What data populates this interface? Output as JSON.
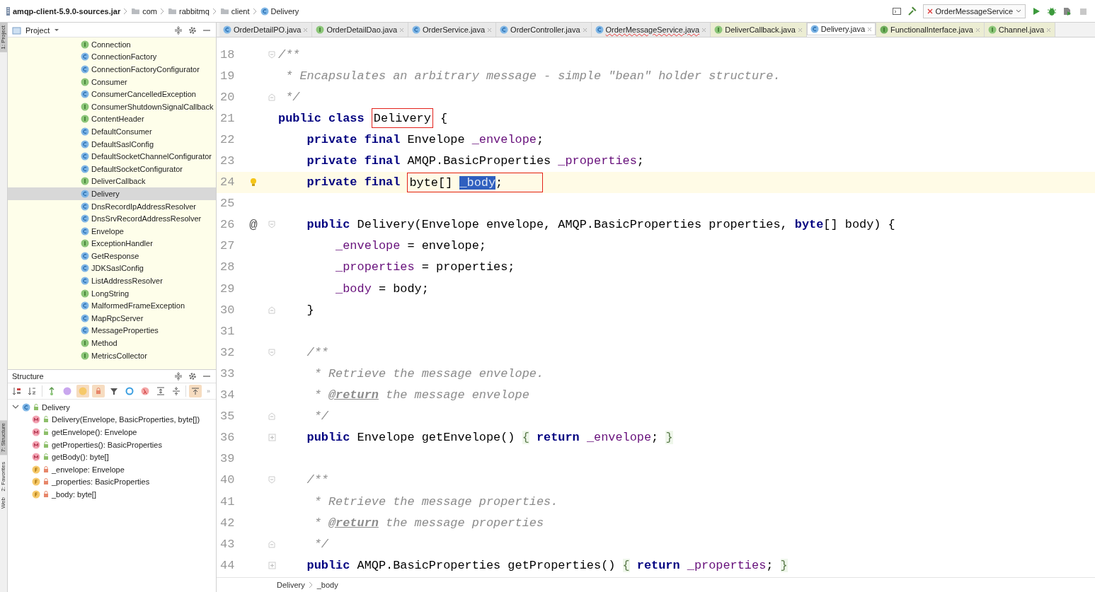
{
  "breadcrumb": [
    {
      "label": "amqp-client-5.9.0-sources.jar",
      "kind": "jar"
    },
    {
      "label": "com",
      "kind": "folder"
    },
    {
      "label": "rabbitmq",
      "kind": "folder"
    },
    {
      "label": "client",
      "kind": "folder"
    },
    {
      "label": "Delivery",
      "kind": "class"
    }
  ],
  "run_config": {
    "label": "OrderMessageService"
  },
  "side_tools": [
    {
      "label": "1: Project",
      "selected": true
    },
    {
      "label": "7: Structure",
      "selected": true
    },
    {
      "label": "2: Favorites",
      "selected": false
    },
    {
      "label": "Web",
      "selected": false
    }
  ],
  "project": {
    "title": "Project",
    "items": [
      {
        "label": "Connection",
        "kind": "interface",
        "selected": false
      },
      {
        "label": "ConnectionFactory",
        "kind": "class",
        "selected": false
      },
      {
        "label": "ConnectionFactoryConfigurator",
        "kind": "class",
        "selected": false
      },
      {
        "label": "Consumer",
        "kind": "interface",
        "selected": false
      },
      {
        "label": "ConsumerCancelledException",
        "kind": "class",
        "selected": false
      },
      {
        "label": "ConsumerShutdownSignalCallback",
        "kind": "interface",
        "selected": false
      },
      {
        "label": "ContentHeader",
        "kind": "interface",
        "selected": false
      },
      {
        "label": "DefaultConsumer",
        "kind": "class",
        "selected": false
      },
      {
        "label": "DefaultSaslConfig",
        "kind": "class",
        "selected": false
      },
      {
        "label": "DefaultSocketChannelConfigurator",
        "kind": "class",
        "selected": false
      },
      {
        "label": "DefaultSocketConfigurator",
        "kind": "class",
        "selected": false
      },
      {
        "label": "DeliverCallback",
        "kind": "interface",
        "selected": false
      },
      {
        "label": "Delivery",
        "kind": "class",
        "selected": true
      },
      {
        "label": "DnsRecordIpAddressResolver",
        "kind": "class",
        "selected": false
      },
      {
        "label": "DnsSrvRecordAddressResolver",
        "kind": "class",
        "selected": false
      },
      {
        "label": "Envelope",
        "kind": "class",
        "selected": false
      },
      {
        "label": "ExceptionHandler",
        "kind": "interface",
        "selected": false
      },
      {
        "label": "GetResponse",
        "kind": "class",
        "selected": false
      },
      {
        "label": "JDKSaslConfig",
        "kind": "class",
        "selected": false
      },
      {
        "label": "ListAddressResolver",
        "kind": "class",
        "selected": false
      },
      {
        "label": "LongString",
        "kind": "interface",
        "selected": false
      },
      {
        "label": "MalformedFrameException",
        "kind": "class",
        "selected": false
      },
      {
        "label": "MapRpcServer",
        "kind": "class",
        "selected": false
      },
      {
        "label": "MessageProperties",
        "kind": "class",
        "selected": false
      },
      {
        "label": "Method",
        "kind": "interface",
        "selected": false
      },
      {
        "label": "MetricsCollector",
        "kind": "interface",
        "selected": false
      }
    ]
  },
  "structure": {
    "title": "Structure",
    "toolbar": [
      {
        "on": false
      },
      {
        "on": false
      },
      {
        "on": false
      },
      {
        "on": false
      },
      {
        "on": true
      },
      {
        "on": true
      },
      {
        "on": false
      },
      {
        "on": false
      },
      {
        "on": false
      },
      {
        "on": false
      },
      {
        "on": false
      },
      {
        "on": true
      }
    ],
    "overflow": "»",
    "tree": [
      {
        "label": "Delivery",
        "kind": "class",
        "locked": false,
        "expanded": true,
        "children": [
          {
            "label": "Delivery(Envelope, BasicProperties, byte[])",
            "kind": "method",
            "locked": false
          },
          {
            "label": "getEnvelope(): Envelope",
            "kind": "method",
            "locked": false
          },
          {
            "label": "getProperties(): BasicProperties",
            "kind": "method",
            "locked": false
          },
          {
            "label": "getBody(): byte[]",
            "kind": "method",
            "locked": false
          },
          {
            "label": "_envelope: Envelope",
            "kind": "field",
            "locked": true
          },
          {
            "label": "_properties: BasicProperties",
            "kind": "field",
            "locked": true
          },
          {
            "label": "_body: byte[]",
            "kind": "field",
            "locked": true
          }
        ]
      }
    ]
  },
  "tabs": [
    {
      "label": "OrderDetailPO.java",
      "kind": "class",
      "selected": false,
      "error": false,
      "color": "#e9e9e9"
    },
    {
      "label": "OrderDetailDao.java",
      "kind": "interface",
      "selected": false,
      "error": false,
      "color": "#e9e9e9"
    },
    {
      "label": "OrderService.java",
      "kind": "class",
      "selected": false,
      "error": false,
      "color": "#e9e9e9"
    },
    {
      "label": "OrderController.java",
      "kind": "class",
      "selected": false,
      "error": false,
      "color": "#e9e9e9"
    },
    {
      "label": "OrderMessageService.java",
      "kind": "class",
      "selected": false,
      "error": true,
      "color": "#e9e9e9"
    },
    {
      "label": "DeliverCallback.java",
      "kind": "interface",
      "selected": false,
      "error": false,
      "color": "#ecedd3"
    },
    {
      "label": "Delivery.java",
      "kind": "class",
      "selected": true,
      "error": false,
      "color": "#ffffff"
    },
    {
      "label": "FunctionalInterface.java",
      "kind": "annotation",
      "selected": false,
      "error": false,
      "color": "#ecedd3"
    },
    {
      "label": "Channel.java",
      "kind": "interface",
      "selected": false,
      "error": false,
      "color": "#ecedd3"
    }
  ],
  "editor": {
    "lines": [
      {
        "num": "18",
        "fold": {
          "kind": "start"
        },
        "tokens": [
          {
            "t": "/**",
            "kind": "comment"
          }
        ]
      },
      {
        "num": "19",
        "tokens": [
          {
            "t": " * Encapsulates an arbitrary message - simple \"bean\" holder structure.",
            "kind": "comment"
          }
        ]
      },
      {
        "num": "20",
        "fold": {
          "kind": "end"
        },
        "tokens": [
          {
            "t": " */",
            "kind": "comment"
          }
        ]
      },
      {
        "num": "21",
        "tokens": [
          {
            "t": "public class ",
            "kind": "keyword"
          },
          {
            "t": "Delivery",
            "kind": "plain",
            "boxed": true
          },
          {
            "t": " {",
            "kind": "plain"
          }
        ]
      },
      {
        "num": "22",
        "tokens": [
          {
            "t": "    private final",
            "kind": "keyword"
          },
          {
            "t": " Envelope ",
            "kind": "plain"
          },
          {
            "t": "_envelope",
            "kind": "field"
          },
          {
            "t": ";",
            "kind": "plain"
          }
        ]
      },
      {
        "num": "23",
        "tokens": [
          {
            "t": "    private final",
            "kind": "keyword"
          },
          {
            "t": " AMQP.BasicProperties ",
            "kind": "plain"
          },
          {
            "t": "_properties",
            "kind": "field"
          },
          {
            "t": ";",
            "kind": "plain"
          }
        ]
      },
      {
        "num": "24",
        "current": true,
        "bulb": true,
        "tokens": [
          {
            "t": "    private final ",
            "kind": "keyword"
          },
          {
            "t": "byte[] ",
            "kind": "plain",
            "boxed": true
          },
          {
            "t": "_body",
            "kind": "selection",
            "boxed": true
          },
          {
            "t": ";",
            "kind": "plain",
            "boxed": true
          }
        ]
      },
      {
        "num": "25",
        "current": false
      },
      {
        "num": "26",
        "gutter_text": "@",
        "fold": {
          "kind": "start"
        },
        "tokens": [
          {
            "t": "    public",
            "kind": "keyword"
          },
          {
            "t": " Delivery(Envelope envelope, AMQP.BasicProperties properties, ",
            "kind": "plain"
          },
          {
            "t": "byte",
            "kind": "keyword"
          },
          {
            "t": "[] body) {",
            "kind": "plain"
          }
        ]
      },
      {
        "num": "27",
        "tokens": [
          {
            "t": "        _envelope",
            "kind": "field"
          },
          {
            "t": " = envelope;",
            "kind": "plain"
          }
        ]
      },
      {
        "num": "28",
        "tokens": [
          {
            "t": "        _properties",
            "kind": "field"
          },
          {
            "t": " = properties;",
            "kind": "plain"
          }
        ]
      },
      {
        "num": "29",
        "tokens": [
          {
            "t": "        _body",
            "kind": "field"
          },
          {
            "t": " = body;",
            "kind": "plain"
          }
        ]
      },
      {
        "num": "30",
        "fold": {
          "kind": "end"
        },
        "tokens": [
          {
            "t": "    }",
            "kind": "plain"
          }
        ]
      },
      {
        "num": "31"
      },
      {
        "num": "32",
        "fold": {
          "kind": "start"
        },
        "tokens": [
          {
            "t": "    /**",
            "kind": "comment"
          }
        ]
      },
      {
        "num": "33",
        "tokens": [
          {
            "t": "     * Retrieve the message envelope.",
            "kind": "comment"
          }
        ]
      },
      {
        "num": "34",
        "tokens": [
          {
            "t": "     * ",
            "kind": "comment"
          },
          {
            "t": "@return",
            "kind": "tag"
          },
          {
            "t": " the message envelope",
            "kind": "comment"
          }
        ]
      },
      {
        "num": "35",
        "fold": {
          "kind": "end"
        },
        "tokens": [
          {
            "t": "     */",
            "kind": "comment"
          }
        ]
      },
      {
        "num": "36",
        "fold": {
          "kind": "collapsed"
        },
        "tokens": [
          {
            "t": "    public",
            "kind": "keyword"
          },
          {
            "t": " Envelope getEnvelope() ",
            "kind": "plain"
          },
          {
            "t": "{",
            "kind": "folded"
          },
          {
            "t": " return ",
            "kind": "keyword"
          },
          {
            "t": "_envelope",
            "kind": "field"
          },
          {
            "t": "; ",
            "kind": "plain"
          },
          {
            "t": "}",
            "kind": "folded"
          }
        ]
      },
      {
        "num": "39"
      },
      {
        "num": "40",
        "fold": {
          "kind": "start"
        },
        "tokens": [
          {
            "t": "    /**",
            "kind": "comment"
          }
        ]
      },
      {
        "num": "41",
        "tokens": [
          {
            "t": "     * Retrieve the message properties.",
            "kind": "comment"
          }
        ]
      },
      {
        "num": "42",
        "tokens": [
          {
            "t": "     * ",
            "kind": "comment"
          },
          {
            "t": "@return",
            "kind": "tag"
          },
          {
            "t": " the message properties",
            "kind": "comment"
          }
        ]
      },
      {
        "num": "43",
        "fold": {
          "kind": "end"
        },
        "tokens": [
          {
            "t": "     */",
            "kind": "comment"
          }
        ]
      },
      {
        "num": "44",
        "fold": {
          "kind": "collapsed"
        },
        "tokens": [
          {
            "t": "    public",
            "kind": "keyword"
          },
          {
            "t": " AMQP.BasicProperties getProperties() ",
            "kind": "plain"
          },
          {
            "t": "{",
            "kind": "folded"
          },
          {
            "t": " return ",
            "kind": "keyword"
          },
          {
            "t": "_properties",
            "kind": "field"
          },
          {
            "t": "; ",
            "kind": "plain"
          },
          {
            "t": "}",
            "kind": "folded"
          }
        ]
      }
    ],
    "breadcrumb": [
      "Delivery",
      "_body"
    ]
  }
}
